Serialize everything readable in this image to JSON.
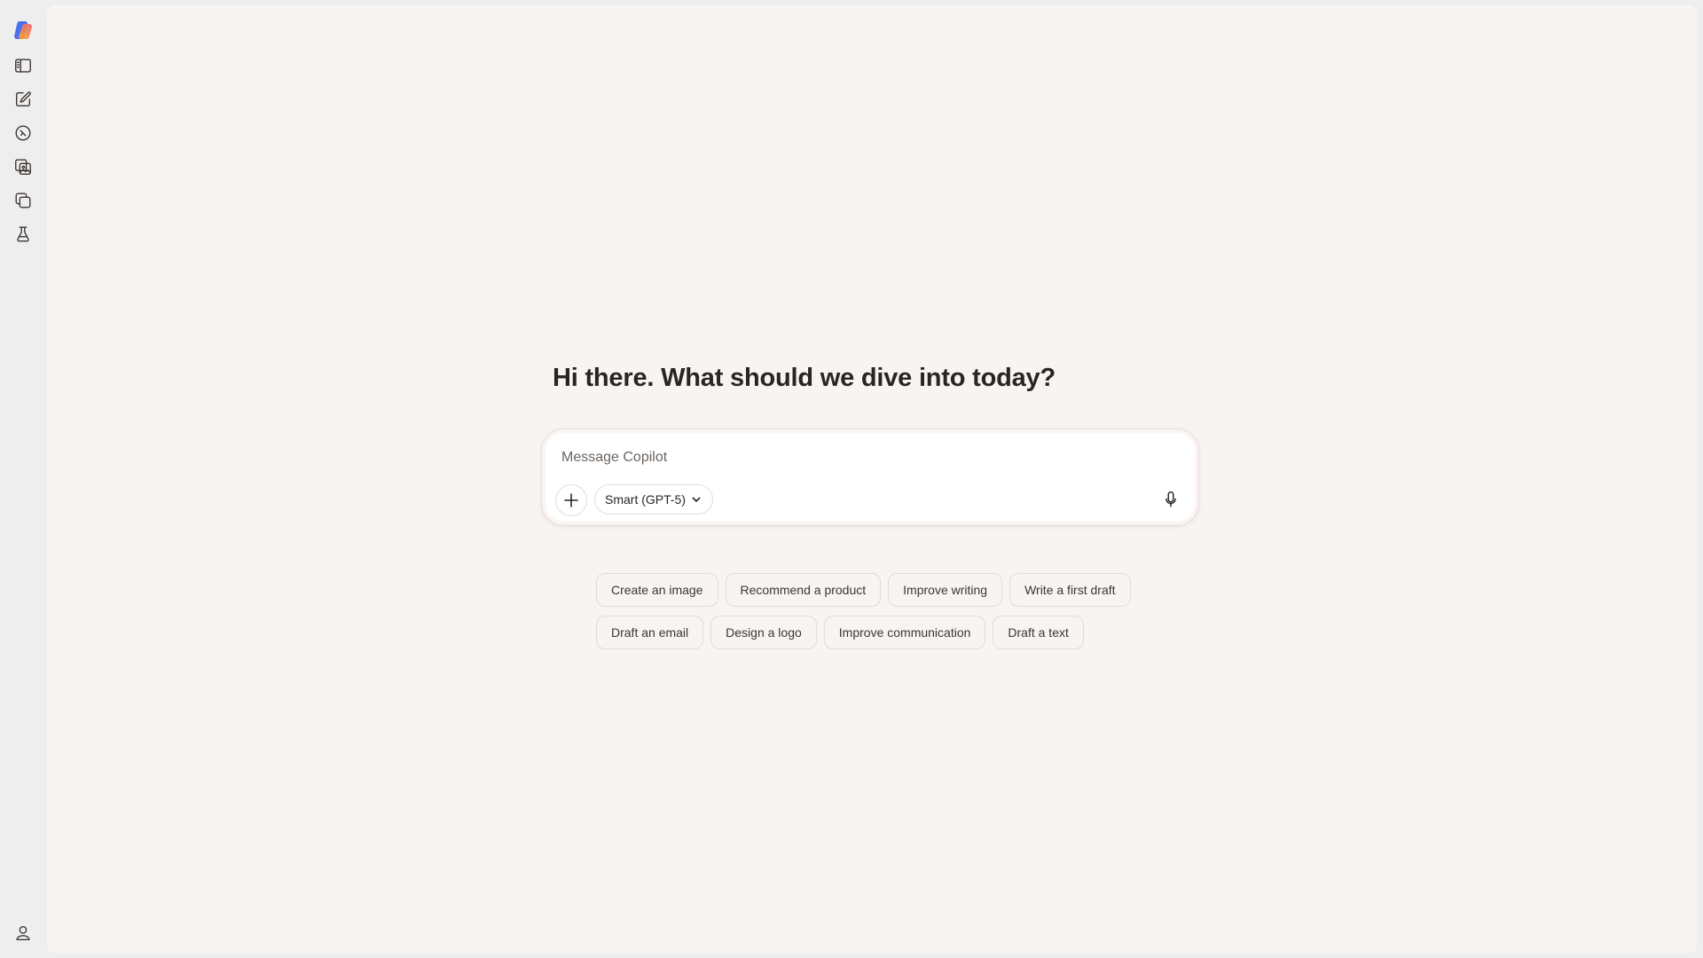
{
  "sidebar": {
    "items": [
      {
        "name": "copilot-logo",
        "icon": "copilot-logo"
      },
      {
        "name": "toggle-sidebar",
        "icon": "sidebar-panel-icon"
      },
      {
        "name": "new-chat",
        "icon": "compose-icon"
      },
      {
        "name": "discover",
        "icon": "compass-icon"
      },
      {
        "name": "imagine",
        "icon": "image-gallery-icon"
      },
      {
        "name": "pages",
        "icon": "copy-pages-icon"
      },
      {
        "name": "labs",
        "icon": "flask-icon"
      }
    ],
    "profile_icon": "person-icon"
  },
  "main": {
    "greeting": "Hi there. What should we dive into today?",
    "composer": {
      "placeholder": "Message Copilot",
      "value": "",
      "model_label": "Smart (GPT-5)"
    },
    "suggestions_row1": [
      "Create an image",
      "Recommend a product",
      "Improve writing",
      "Write a first draft"
    ],
    "suggestions_row2": [
      "Draft an email",
      "Design a logo",
      "Improve communication",
      "Draft a text"
    ]
  },
  "colors": {
    "page_background": "#f8f4f1",
    "sidebar_background": "#efeeee",
    "text": "#2a2522"
  }
}
